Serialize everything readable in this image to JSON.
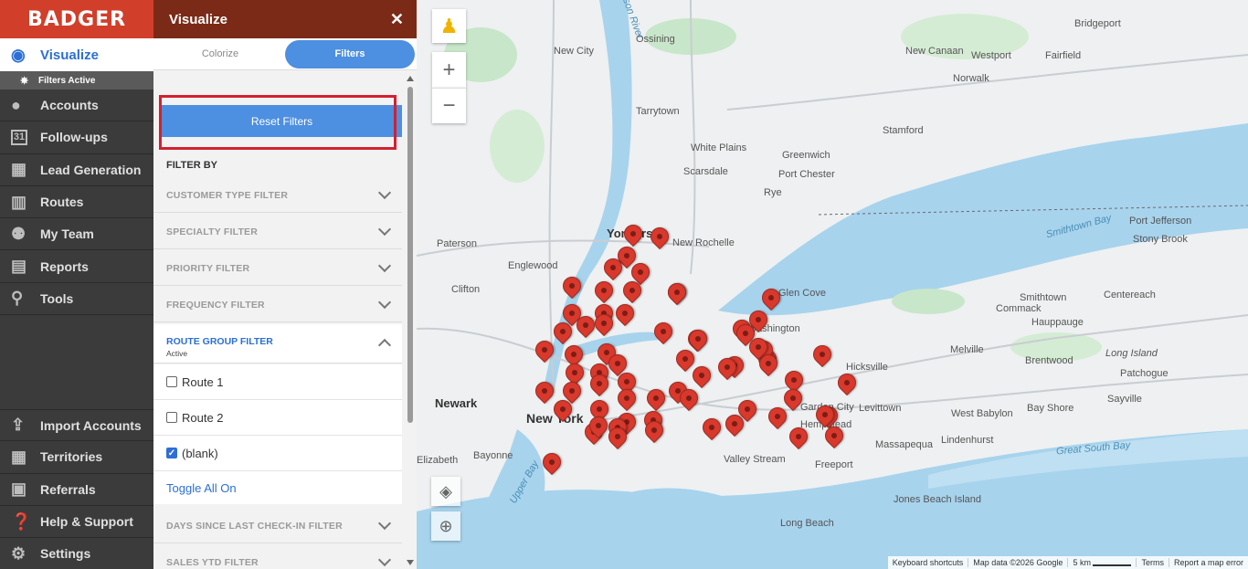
{
  "brand": "BADGER",
  "nav": {
    "active": "Visualize",
    "sub": "Filters Active",
    "items": [
      "Accounts",
      "Follow-ups",
      "Lead Generation",
      "Routes",
      "My Team",
      "Reports",
      "Tools"
    ],
    "bottom": [
      "Import Accounts",
      "Territories",
      "Referrals",
      "Help & Support",
      "Settings"
    ],
    "calendar_day": "31"
  },
  "panel": {
    "title": "Visualize",
    "close": "✕",
    "tabs": [
      "Colorize",
      "Filters"
    ],
    "reset": "Reset Filters",
    "filter_by": "FILTER BY",
    "filters_top": [
      "CUSTOMER TYPE FILTER",
      "SPECIALTY FILTER",
      "PRIORITY FILTER",
      "FREQUENCY FILTER"
    ],
    "route_group": {
      "label": "ROUTE GROUP FILTER",
      "status": "Active"
    },
    "options": [
      {
        "label": "Route 1",
        "checked": false
      },
      {
        "label": "Route 2",
        "checked": false
      },
      {
        "label": "(blank)",
        "checked": true
      }
    ],
    "toggle": "Toggle All On",
    "filters_bottom": [
      "DAYS SINCE LAST CHECK-IN FILTER",
      "SALES YTD FILTER"
    ]
  },
  "map": {
    "labels": {
      "new_york": "New York",
      "newark": "Newark",
      "yonkers": "Yonkers",
      "new_rochelle": "New Rochelle",
      "white_plains": "White Plains",
      "tarrytown": "Tarrytown",
      "greenwich": "Greenwich",
      "stamford": "Stamford",
      "norwalk": "Norwalk",
      "new_canaan": "New Canaan",
      "bridgeport": "Bridgeport",
      "fairfield": "Fairfield",
      "westport": "Westport",
      "port_chester": "Port Chester",
      "rye": "Rye",
      "scarsdale": "Scarsdale",
      "ossining": "Ossining",
      "new_city": "New City",
      "paterson": "Paterson",
      "englewood": "Englewood",
      "clifton": "Clifton",
      "glen_cove": "Glen Cove",
      "hicksville": "Hicksville",
      "levittown": "Levittown",
      "massapequa": "Massapequa",
      "freeport": "Freeport",
      "valley_stream": "Valley Stream",
      "long_beach": "Long Beach",
      "jones_beach": "Jones Beach Island",
      "lindenhurst": "Lindenhurst",
      "west_babylon": "West Babylon",
      "bay_shore": "Bay Shore",
      "sayville": "Sayville",
      "patchogue": "Patchogue",
      "brentwood": "Brentwood",
      "melville": "Melville",
      "commack": "Commack",
      "smithtown": "Smithtown",
      "centereach": "Centereach",
      "hauppauge": "Hauppauge",
      "stony_brook": "Stony Brook",
      "port_jefferson": "Port Jefferson",
      "long_island": "Long Island",
      "smithtown_bay": "Smithtown Bay",
      "great_south_bay": "Great South Bay",
      "upper_bay": "Upper Bay",
      "bayonne": "Bayonne",
      "elizabeth": "Elizabeth",
      "hudson_river": "Hudson River",
      "garden_city": "Garden City",
      "hempstead": "Hempstead",
      "washington": "Washington"
    },
    "footer": [
      "Keyboard shortcuts",
      "Map data ©2026 Google",
      "5 km",
      "Terms",
      "Report a map error"
    ],
    "zoom_in": "+",
    "zoom_out": "−"
  }
}
